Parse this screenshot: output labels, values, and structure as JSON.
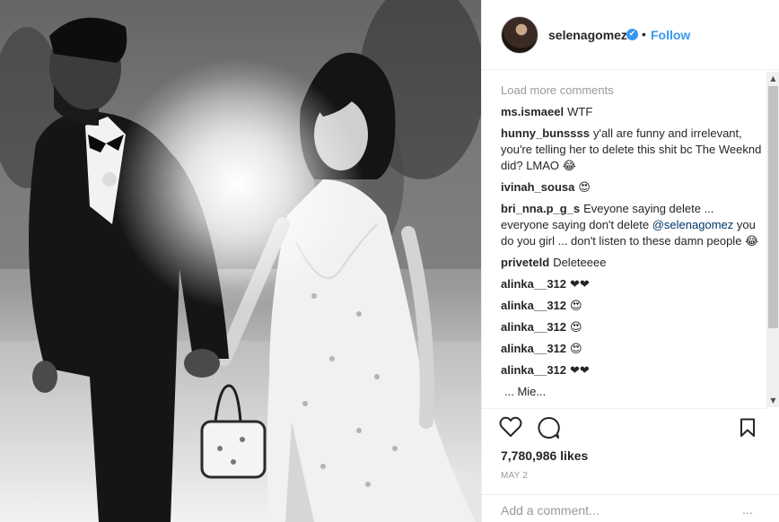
{
  "post": {
    "username": "selenagomez",
    "verified_glyph": "✔",
    "separator": "•",
    "follow_label": "Follow"
  },
  "comments": {
    "load_more": "Load more comments",
    "items": [
      {
        "author": "ms.ismaeel",
        "text": "WTF"
      },
      {
        "author": "hunny_bunssss",
        "text": "y'all are funny and irrelevant, you're telling her to delete this shit bc The Weeknd did? LMAO 😂"
      },
      {
        "author": "ivinah_sousa",
        "text": "😍"
      },
      {
        "author": "bri_nna.p_g_s",
        "text": "Eveyone saying delete ... everyone saying don't delete",
        "mention": "@selenagomez",
        "text_after": "you do you girl ... don't listen to these damn people 😂"
      },
      {
        "author": "priveteld",
        "text": "Deleteeee"
      },
      {
        "author": "alinka__312",
        "text": "❤❤"
      },
      {
        "author": "alinka__312",
        "text": "😍"
      },
      {
        "author": "alinka__312",
        "text": "😍"
      },
      {
        "author": "alinka__312",
        "text": "😍"
      },
      {
        "author": "alinka__312",
        "text": "❤❤"
      },
      {
        "author": "",
        "text": "... Mie..."
      }
    ]
  },
  "actions": {
    "likes": "7,780,986 likes",
    "date": "MAY 2"
  },
  "composer": {
    "placeholder": "Add a comment...",
    "more": "..."
  },
  "scrollbar": {
    "up": "▲",
    "down": "▼"
  },
  "colors": {
    "accent": "#3897f0",
    "text": "#262626",
    "muted": "#999999",
    "border": "#efefef"
  },
  "icons": [
    "heart-icon",
    "comment-icon",
    "bookmark-icon",
    "verified-icon"
  ]
}
